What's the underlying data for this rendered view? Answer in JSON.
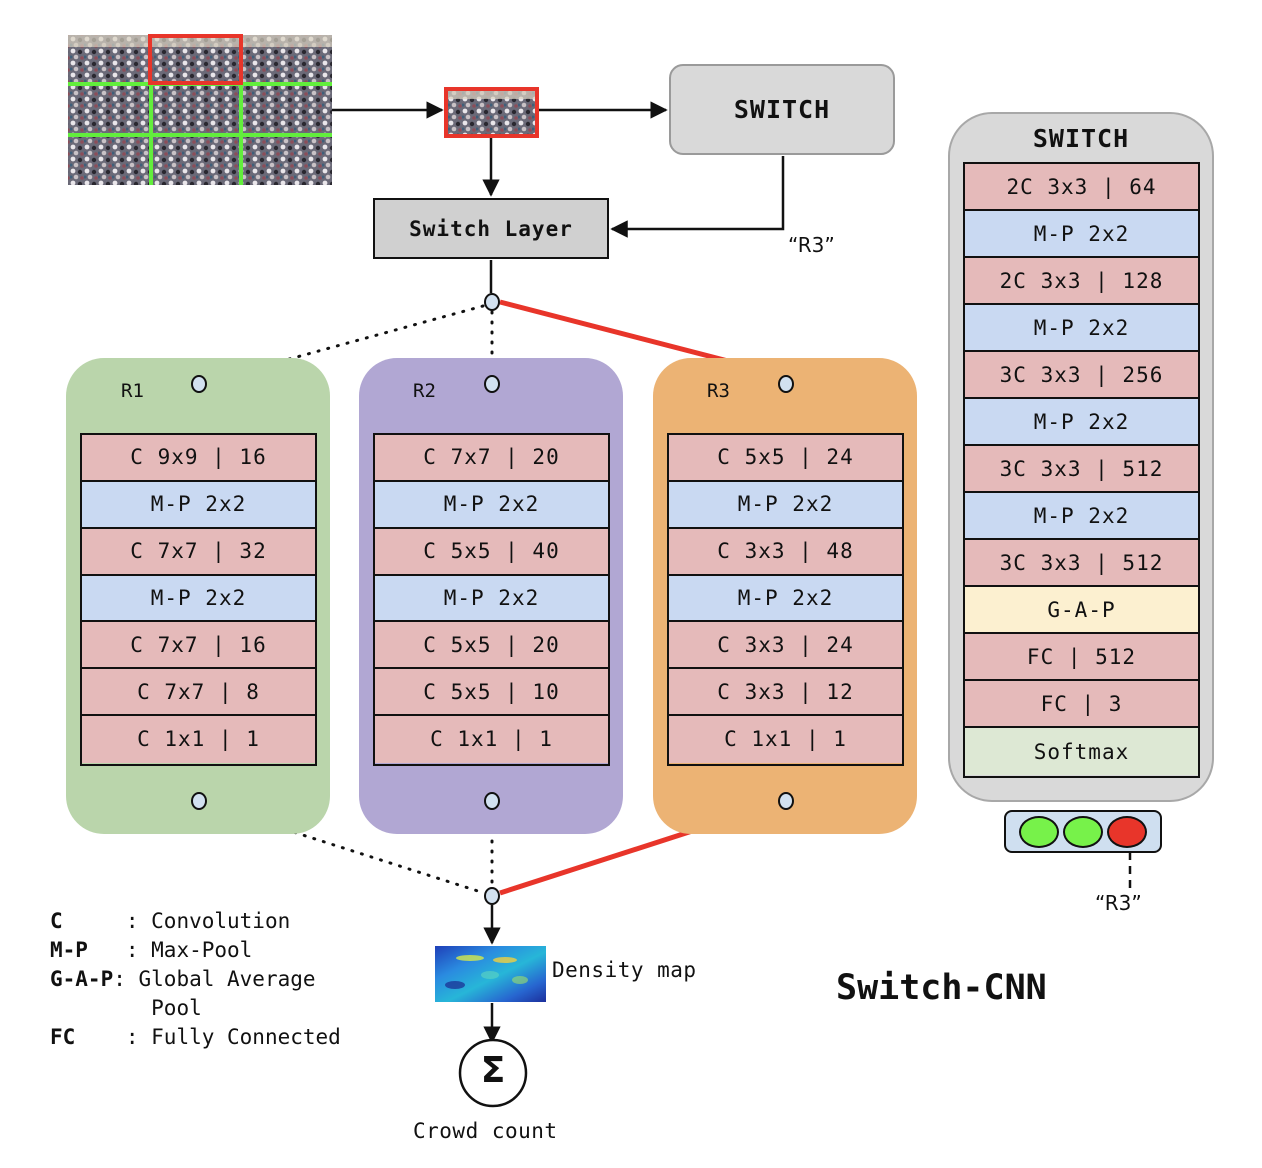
{
  "title": "Switch-CNN",
  "switch_box": {
    "label": "SWITCH",
    "output_label": "“R3”"
  },
  "switch_layer": {
    "label": "Switch Layer"
  },
  "regressors": [
    {
      "name": "R1",
      "color": "#bad5ab",
      "layers": [
        {
          "type": "conv",
          "label": "C 9x9 | 16"
        },
        {
          "type": "pool",
          "label": "M-P 2x2"
        },
        {
          "type": "conv",
          "label": "C 7x7 | 32"
        },
        {
          "type": "pool",
          "label": "M-P 2x2"
        },
        {
          "type": "conv",
          "label": "C 7x7 | 16"
        },
        {
          "type": "conv",
          "label": "C 7x7 | 8"
        },
        {
          "type": "conv",
          "label": "C 1x1 | 1"
        }
      ]
    },
    {
      "name": "R2",
      "color": "#b1a7d3",
      "layers": [
        {
          "type": "conv",
          "label": "C 7x7 | 20"
        },
        {
          "type": "pool",
          "label": "M-P 2x2"
        },
        {
          "type": "conv",
          "label": "C 5x5 | 40"
        },
        {
          "type": "pool",
          "label": "M-P 2x2"
        },
        {
          "type": "conv",
          "label": "C 5x5 | 20"
        },
        {
          "type": "conv",
          "label": "C 5x5 | 10"
        },
        {
          "type": "conv",
          "label": "C 1x1 | 1"
        }
      ]
    },
    {
      "name": "R3",
      "color": "#ecb374",
      "layers": [
        {
          "type": "conv",
          "label": "C 5x5 | 24"
        },
        {
          "type": "pool",
          "label": "M-P 2x2"
        },
        {
          "type": "conv",
          "label": "C 3x3 | 48"
        },
        {
          "type": "pool",
          "label": "M-P 2x2"
        },
        {
          "type": "conv",
          "label": "C 3x3 | 24"
        },
        {
          "type": "conv",
          "label": "C 3x3 | 12"
        },
        {
          "type": "conv",
          "label": "C 1x1 | 1"
        }
      ]
    }
  ],
  "selected_regressor": "R3",
  "switch_classifier": {
    "title": "SWITCH",
    "layers": [
      {
        "type": "conv",
        "label": "2C 3x3 | 64"
      },
      {
        "type": "pool",
        "label": "M-P 2x2"
      },
      {
        "type": "conv",
        "label": "2C 3x3 | 128"
      },
      {
        "type": "pool",
        "label": "M-P 2x2"
      },
      {
        "type": "conv",
        "label": "3C 3x3 | 256"
      },
      {
        "type": "pool",
        "label": "M-P 2x2"
      },
      {
        "type": "conv",
        "label": "3C 3x3 | 512"
      },
      {
        "type": "pool",
        "label": "M-P 2x2"
      },
      {
        "type": "conv",
        "label": "3C 3x3 | 512"
      },
      {
        "type": "gap",
        "label": "G-A-P"
      },
      {
        "type": "conv",
        "label": "FC | 512"
      },
      {
        "type": "conv",
        "label": "FC | 3"
      },
      {
        "type": "soft",
        "label": "Softmax"
      }
    ],
    "outputs": [
      {
        "state": "off",
        "color": "#77f24a"
      },
      {
        "state": "off",
        "color": "#77f24a"
      },
      {
        "state": "on",
        "color": "#e8352a"
      }
    ],
    "output_label": "“R3”"
  },
  "density_map_label": "Density map",
  "crowd_count_label": "Crowd count",
  "sum_symbol": "Σ",
  "legend": [
    {
      "abbr": "C     ",
      "desc": "Convolution"
    },
    {
      "abbr": "M-P   ",
      "desc": "Max-Pool"
    },
    {
      "abbr": "G-A-P",
      "desc": "Global Average"
    },
    {
      "abbr": "      ",
      "desc": "Pool"
    },
    {
      "abbr": "FC    ",
      "desc": "Fully Connected"
    }
  ],
  "colors": {
    "active_path": "#e8352a",
    "grid": "#62ee3c",
    "node": "#d2e1f0"
  }
}
